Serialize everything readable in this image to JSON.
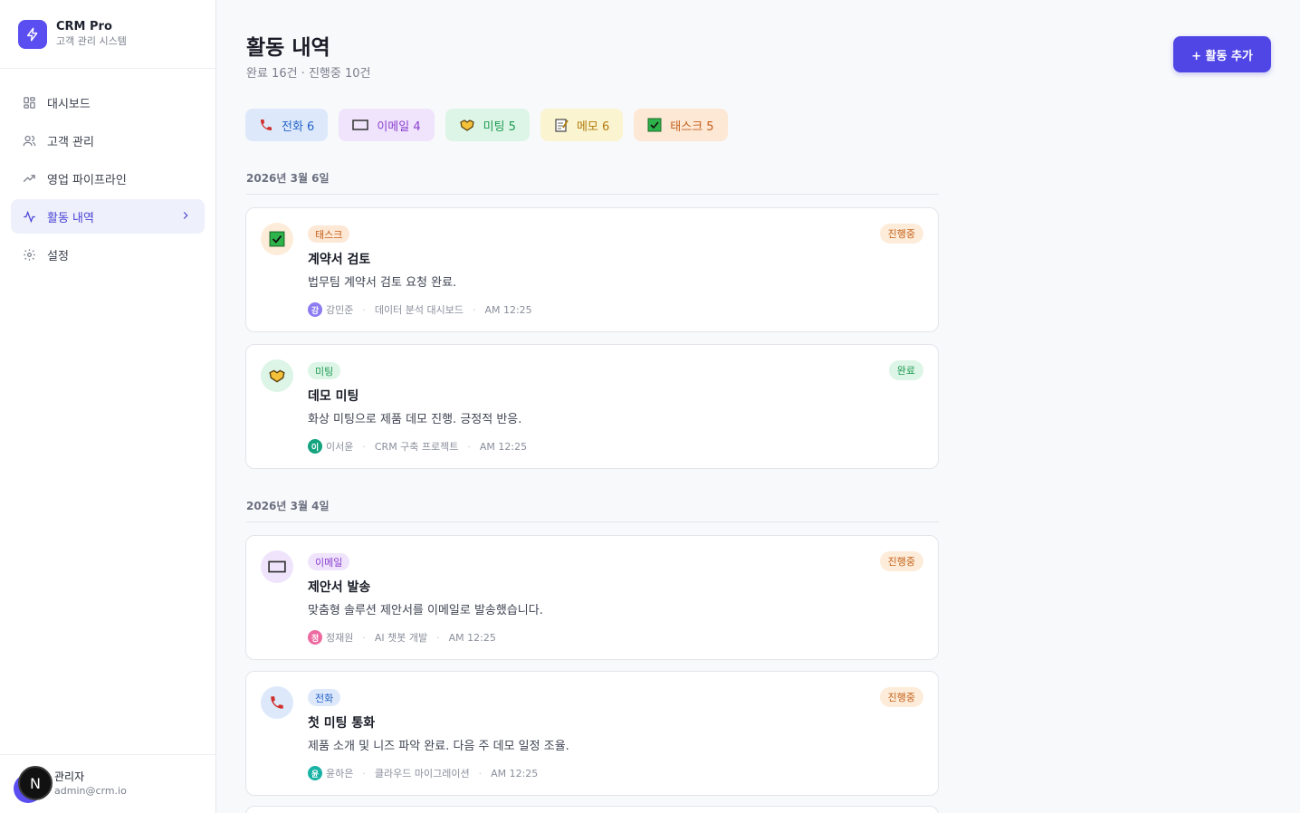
{
  "sidebar": {
    "brand_title": "CRM Pro",
    "brand_sub": "고객 관리 시스템",
    "items": [
      {
        "label": "대시보드",
        "icon": "grid-icon"
      },
      {
        "label": "고객 관리",
        "icon": "users-icon"
      },
      {
        "label": "영업 파이프라인",
        "icon": "trending-up-icon"
      },
      {
        "label": "활동 내역",
        "icon": "activity-icon",
        "active": true
      },
      {
        "label": "설정",
        "icon": "gear-icon"
      }
    ],
    "user": {
      "initial": "N",
      "name": "관리자",
      "email": "admin@crm.io"
    }
  },
  "header": {
    "title": "활동 내역",
    "subtitle": "완료 16건 · 진행중 10건",
    "add_button": "+ 활동 추가"
  },
  "filters": [
    {
      "label": "전화 6",
      "icon": "phone-icon"
    },
    {
      "label": "이메일 4",
      "icon": "envelope-icon"
    },
    {
      "label": "미팅 5",
      "icon": "handshake-icon"
    },
    {
      "label": "메모 6",
      "icon": "memo-icon"
    },
    {
      "label": "태스크 5",
      "icon": "checkbox-icon"
    }
  ],
  "groups": [
    {
      "date": "2026년 3월 6일",
      "activities": [
        {
          "type": "태스크",
          "title": "계약서 검토",
          "desc": "법무팀 계약서 검토 요청 완료.",
          "user_initial": "강",
          "user": "강민준",
          "project": "데이터 분석 대시보드",
          "time": "AM 12:25",
          "status": "진행중"
        },
        {
          "type": "미팅",
          "title": "데모 미팅",
          "desc": "화상 미팅으로 제품 데모 진행. 긍정적 반응.",
          "user_initial": "이",
          "user": "이서윤",
          "project": "CRM 구축 프로젝트",
          "time": "AM 12:25",
          "status": "완료"
        }
      ]
    },
    {
      "date": "2026년 3월 4일",
      "activities": [
        {
          "type": "이메일",
          "title": "제안서 발송",
          "desc": "맞춤형 솔루션 제안서를 이메일로 발송했습니다.",
          "user_initial": "정",
          "user": "정재원",
          "project": "AI 챗봇 개발",
          "time": "AM 12:25",
          "status": "진행중"
        },
        {
          "type": "전화",
          "title": "첫 미팅 통화",
          "desc": "제품 소개 및 니즈 파악 완료. 다음 주 데모 일정 조율.",
          "user_initial": "윤",
          "user": "윤하은",
          "project": "클라우드 마이그레이션",
          "time": "AM 12:25",
          "status": "진행중"
        }
      ]
    }
  ],
  "colors": {
    "accent": "#4f46e5",
    "avatar_kang": "#8b7cf0",
    "avatar_lee": "#14a37f",
    "avatar_jung": "#ec6aa0",
    "avatar_yoon": "#19b3a6"
  }
}
